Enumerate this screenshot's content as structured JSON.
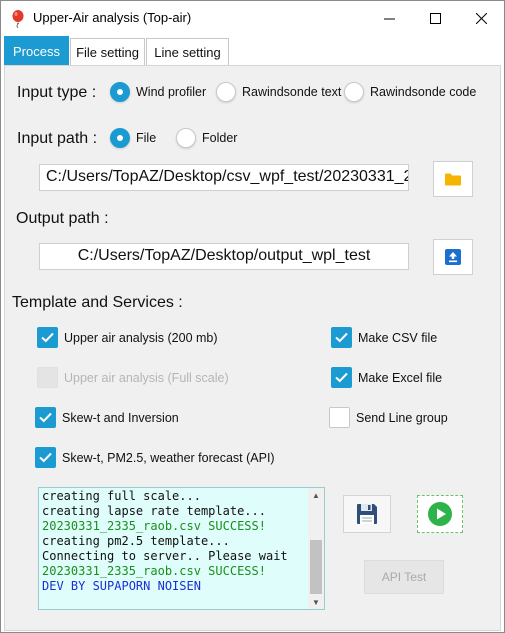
{
  "window": {
    "title": "Upper-Air analysis (Top-air)",
    "minimize_icon": "minimize-icon",
    "maximize_icon": "maximize-icon",
    "close_icon": "close-icon"
  },
  "tabs": [
    {
      "label": "Process",
      "active": true
    },
    {
      "label": "File setting",
      "active": false
    },
    {
      "label": "Line setting",
      "active": false
    }
  ],
  "input_type": {
    "label": "Input type :",
    "options": [
      {
        "label": "Wind profiler",
        "selected": true
      },
      {
        "label": "Rawindsonde text",
        "selected": false
      },
      {
        "label": "Rawindsonde code",
        "selected": false
      }
    ]
  },
  "input_path": {
    "label": "Input path :",
    "options": [
      {
        "label": "File",
        "selected": true
      },
      {
        "label": "Folder",
        "selected": false
      }
    ],
    "value": "C:/Users/TopAZ/Desktop/csv_wpf_test/20230331_2",
    "browse_icon": "folder-icon"
  },
  "output_path": {
    "label": "Output path :",
    "value": "C:/Users/TopAZ/Desktop/output_wpl_test",
    "browse_icon": "upload-icon"
  },
  "services": {
    "label": "Template and Services :",
    "items": [
      {
        "label": "Upper air analysis (200 mb)",
        "checked": true,
        "disabled": false
      },
      {
        "label": "Make CSV file",
        "checked": true,
        "disabled": false
      },
      {
        "label": "Upper air analysis (Full scale)",
        "checked": false,
        "disabled": true
      },
      {
        "label": "Make Excel file",
        "checked": true,
        "disabled": false
      },
      {
        "label": "Skew-t and Inversion",
        "checked": true,
        "disabled": false
      },
      {
        "label": "Send Line group",
        "checked": false,
        "disabled": false
      },
      {
        "label": "Skew-t, PM2.5, weather forecast (API)",
        "checked": true,
        "disabled": false
      }
    ]
  },
  "log": {
    "lines": [
      {
        "text": "creating full scale...",
        "color": "#111111"
      },
      {
        "text": "creating lapse rate template...",
        "color": "#111111"
      },
      {
        "text": "20230331_2335_raob.csv SUCCESS!",
        "color": "#1a8f1a"
      },
      {
        "text": "creating pm2.5 template...",
        "color": "#111111"
      },
      {
        "text": "Connecting to server.. Please wait",
        "color": "#111111"
      },
      {
        "text": "20230331_2335_raob.csv SUCCESS!",
        "color": "#1a8f1a"
      },
      {
        "text": "DEV BY SUPAPORN NOISEN",
        "color": "#1a2fd6"
      }
    ]
  },
  "buttons": {
    "save_icon": "save-icon",
    "run_icon": "play-icon",
    "api_test": "API Test"
  },
  "colors": {
    "accent": "#1b9bd1",
    "success": "#1a8f1a",
    "credit": "#1a2fd6",
    "log_bg": "#dffdfb"
  }
}
